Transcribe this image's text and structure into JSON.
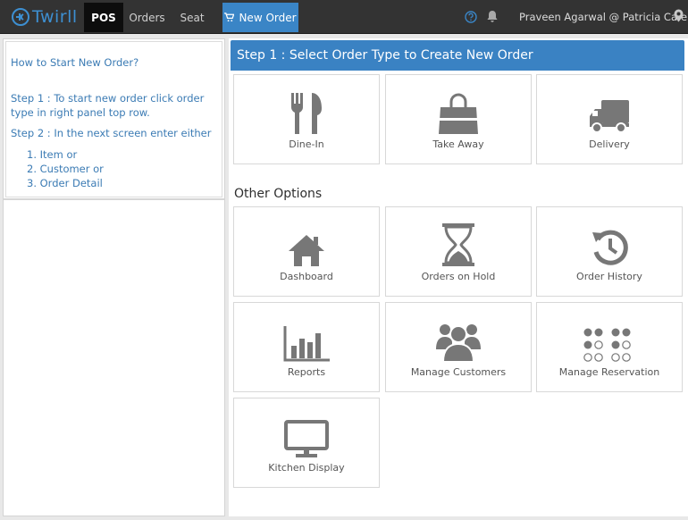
{
  "brand": {
    "name": "Twirll"
  },
  "nav": {
    "pos": "POS",
    "orders": "Orders",
    "seat": "Seat",
    "new_order": "New Order"
  },
  "header": {
    "user": "Praveen Agarwal @ Patricia Cafe"
  },
  "icons": {
    "help": "help-circle-icon",
    "bell": "bell-icon",
    "location": "map-marker-icon",
    "cart": "cart-icon"
  },
  "help": {
    "title": "How to Start New Order?",
    "step1_line1": "Step 1 : To start new order click order",
    "step1_line2": "type in right panel top row.",
    "step2": "Step 2 : In the next screen enter either",
    "items": [
      "1. Item or",
      "2. Customer or",
      "3. Order Detail"
    ]
  },
  "main": {
    "step_title": "Step 1 : Select Order Type to Create New Order",
    "order_types": [
      {
        "label": "Dine-In",
        "icon": "fork-knife-icon"
      },
      {
        "label": "Take Away",
        "icon": "shopping-bag-icon"
      },
      {
        "label": "Delivery",
        "icon": "truck-icon"
      }
    ],
    "other_title": "Other Options",
    "other_options": [
      {
        "label": "Dashboard",
        "icon": "home-icon"
      },
      {
        "label": "Orders on Hold",
        "icon": "hourglass-icon"
      },
      {
        "label": "Order History",
        "icon": "history-icon"
      },
      {
        "label": "Reports",
        "icon": "bar-chart-icon"
      },
      {
        "label": "Manage Customers",
        "icon": "users-icon"
      },
      {
        "label": "Manage Reservation",
        "icon": "seat-grid-icon"
      },
      {
        "label": "Kitchen Display",
        "icon": "monitor-icon"
      }
    ]
  },
  "colors": {
    "topbar": "#333333",
    "accent": "#3a82c3",
    "icon_gray": "#7a7a7a",
    "help_text": "#3b7bb4"
  }
}
